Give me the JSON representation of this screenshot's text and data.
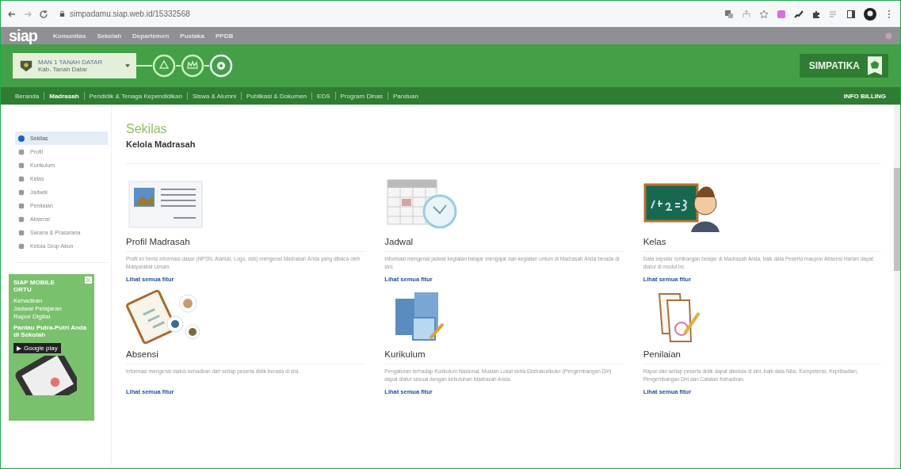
{
  "browser": {
    "url": "simpadamu.siap.web.id/15332568"
  },
  "topbar": {
    "logo": "siap",
    "links": [
      "Komunitas",
      "Sekolah",
      "Departemen",
      "Pustaka",
      "PPDB"
    ]
  },
  "header": {
    "school_name": "MAN 1 TANAH DATAR",
    "school_region": "Kab. Tanah Datar",
    "simpatika": "SIMPATIKA"
  },
  "nav": {
    "items": [
      {
        "label": "Beranda",
        "selected": false
      },
      {
        "label": "Madrasah",
        "selected": true
      },
      {
        "label": "Pendidik & Tenaga Kependidikan",
        "selected": false
      },
      {
        "label": "Siswa & Alumni",
        "selected": false
      },
      {
        "label": "Publikasi & Dokumen",
        "selected": false
      },
      {
        "label": "EDS",
        "selected": false
      },
      {
        "label": "Program Dinas",
        "selected": false
      },
      {
        "label": "Panduan",
        "selected": false
      }
    ],
    "billing": "INFO BILLING"
  },
  "sidebar": {
    "items": [
      {
        "label": "Sekilas",
        "selected": true
      },
      {
        "label": "Profil",
        "selected": false
      },
      {
        "label": "Kurikulum",
        "selected": false
      },
      {
        "label": "Kelas",
        "selected": false
      },
      {
        "label": "Jadwal",
        "selected": false
      },
      {
        "label": "Penilaian",
        "selected": false
      },
      {
        "label": "Absensi",
        "selected": false
      },
      {
        "label": "Sarana & Prasarana",
        "selected": false
      },
      {
        "label": "Kelola Grup Akun",
        "selected": false
      }
    ]
  },
  "ad": {
    "title": "SIAP MOBILE ORTU",
    "features": [
      "Kehadiran",
      "Jadwal Pelajaran",
      "Rapor Digital"
    ],
    "tagline": "Pantau Putra-Putri Anda di Sekolah",
    "store": "Google play"
  },
  "page": {
    "title": "Sekilas",
    "subtitle": "Kelola Madrasah"
  },
  "features": [
    {
      "title": "Profil Madrasah",
      "description": "Profil ini berisi informasi dasar (NPSN, Alamat, Logo, dsb) mengenai Madrasah Anda yang dibaca oleh Masyarakat Umum.",
      "link": "Lihat semua fitur"
    },
    {
      "title": "Jadwal",
      "description": "Informasi mengenai jadwal kegiatan belajar mengajar dan kegiatan umum di Madrasah Anda berada di sini.",
      "link": "Lihat semua fitur"
    },
    {
      "title": "Kelas",
      "description": "Data seputar rombongan belajar di Madrasah Anda, baik data Peserta maupun Absensi Harian dapat diatur di modul ini.",
      "link": "Lihat semua fitur"
    },
    {
      "title": "Absensi",
      "description": "Informasi mengenai status kehadiran dari setiap peserta didik berada di sini.",
      "link": "Lihat semua fitur"
    },
    {
      "title": "Kurikulum",
      "description": "Pengaturan terhadap Kurikulum Nasional, Muatan Lokal serta Ekstrakurikuler (Pengembangan Diri) dapat diatur sesuai dengan kebutuhan Madrasah Anda.",
      "link": "Lihat semua fitur"
    },
    {
      "title": "Penilaian",
      "description": "Rapor dan setiap peserta didik dapat dikelola di sini, baik data Nilai, Kompetensi, Kepribadian, Pengembangan Diri dan Catatan Kehadiran.",
      "link": "Lihat semua fitur"
    }
  ]
}
